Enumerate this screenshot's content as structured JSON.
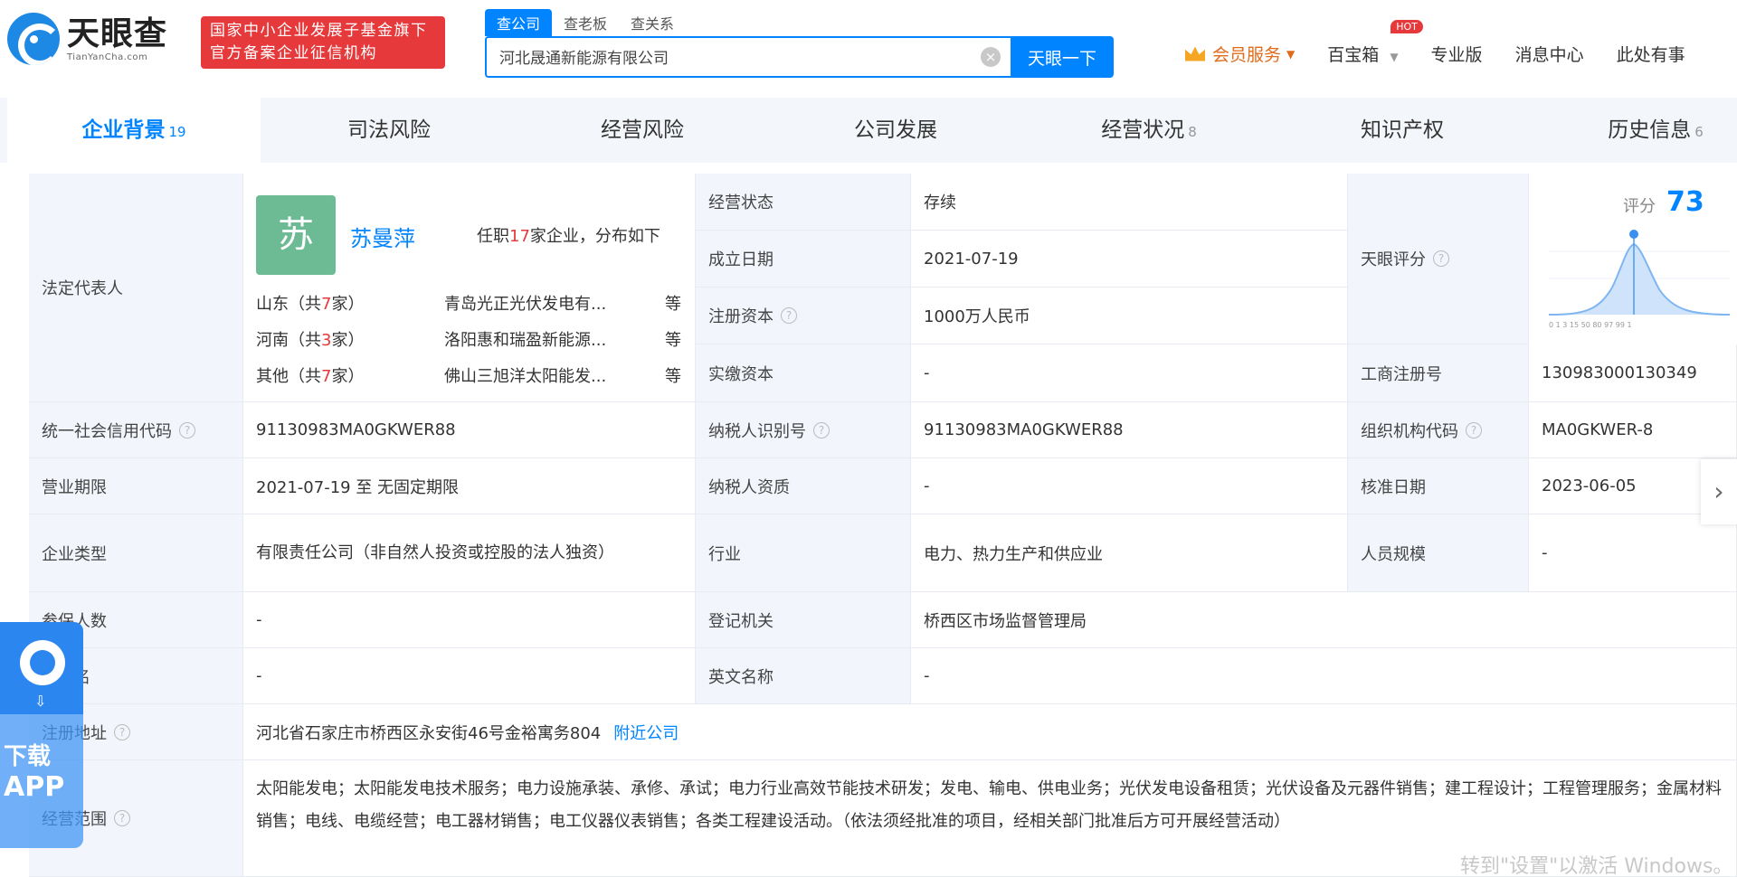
{
  "header": {
    "logo_name": "天眼查",
    "logo_sub": "TianYanCha.com",
    "badge_line1": "国家中小企业发展子基金旗下",
    "badge_line2": "官方备案企业征信机构",
    "search_tabs": [
      "查公司",
      "查老板",
      "查关系"
    ],
    "search_value": "河北晟通新能源有限公司",
    "search_button": "天眼一下",
    "nav": {
      "member": "会员服务",
      "baibaoxiang": "百宝箱",
      "hot": "HOT",
      "pro": "专业版",
      "messages": "消息中心",
      "more": "此处有事"
    }
  },
  "tabs": [
    {
      "label": "企业背景",
      "count": "19"
    },
    {
      "label": "司法风险",
      "count": ""
    },
    {
      "label": "经营风险",
      "count": ""
    },
    {
      "label": "公司发展",
      "count": ""
    },
    {
      "label": "经营状况",
      "count": "8"
    },
    {
      "label": "知识产权",
      "count": ""
    },
    {
      "label": "历史信息",
      "count": "6"
    }
  ],
  "legal": {
    "label": "法定代表人",
    "avatar_char": "苏",
    "name": "苏曼萍",
    "stat_prefix": "任职",
    "stat_count": "17",
    "stat_suffix": "家企业，分布如下",
    "regions": [
      {
        "prefix": "山东（共",
        "count": "7",
        "suffix": "家）",
        "company": "青岛光正光伏发电有...",
        "more": "等"
      },
      {
        "prefix": "河南（共",
        "count": "3",
        "suffix": "家）",
        "company": "洛阳惠和瑞盈新能源...",
        "more": "等"
      },
      {
        "prefix": "其他（共",
        "count": "7",
        "suffix": "家）",
        "company": "佛山三旭洋太阳能发...",
        "more": "等"
      }
    ]
  },
  "score": {
    "label": "天眼评分",
    "prefix": "评分",
    "value": "73",
    "axis": "0  1  3  15  50  80  97  99  1"
  },
  "fields": {
    "status_label": "经营状态",
    "status": "存续",
    "founded_label": "成立日期",
    "founded": "2021-07-19",
    "reg_capital_label": "注册资本",
    "reg_capital": "1000万人民币",
    "paid_capital_label": "实缴资本",
    "paid_capital": "-",
    "biz_reg_no_label": "工商注册号",
    "biz_reg_no": "130983000130349",
    "credit_code_label": "统一社会信用代码",
    "credit_code": "91130983MA0GKWER88",
    "taxpayer_id_label": "纳税人识别号",
    "taxpayer_id": "91130983MA0GKWER88",
    "org_code_label": "组织机构代码",
    "org_code": "MA0GKWER-8",
    "term_label": "营业期限",
    "term": "2021-07-19 至 无固定期限",
    "taxpayer_qual_label": "纳税人资质",
    "taxpayer_qual": "-",
    "approve_date_label": "核准日期",
    "approve_date": "2023-06-05",
    "type_label": "企业类型",
    "type": "有限责任公司（非自然人投资或控股的法人独资）",
    "industry_label": "行业",
    "industry": "电力、热力生产和供应业",
    "staff_size_label": "人员规模",
    "staff_size": "-",
    "insured_label": "参保人数",
    "insured": "-",
    "authority_label": "登记机关",
    "authority": "桥西区市场监督管理局",
    "former_name_label": "曾用名",
    "former_name": "-",
    "english_name_label": "英文名称",
    "english_name": "-",
    "address_label": "注册地址",
    "address": "河北省石家庄市桥西区永安街46号金裕寓务804",
    "nearby": "附近公司",
    "scope_label": "经营范围",
    "scope": "太阳能发电；太阳能发电技术服务；电力设施承装、承修、承试；电力行业高效节能技术研发；发电、输电、供电业务；光伏发电设备租赁；光伏设备及元器件销售；建工程设计；工程管理服务；金属材料销售；电线、电缆经营；电工器材销售；电工仪器仪表销售；各类工程建设活动。（依法须经批准的项目，经相关部门批准后方可开展经营活动）"
  },
  "float_app": {
    "line1": "下载",
    "line2": "APP",
    "download_hint": "⇩"
  },
  "watermark": "转到\"设置\"以激活 Windows。"
}
